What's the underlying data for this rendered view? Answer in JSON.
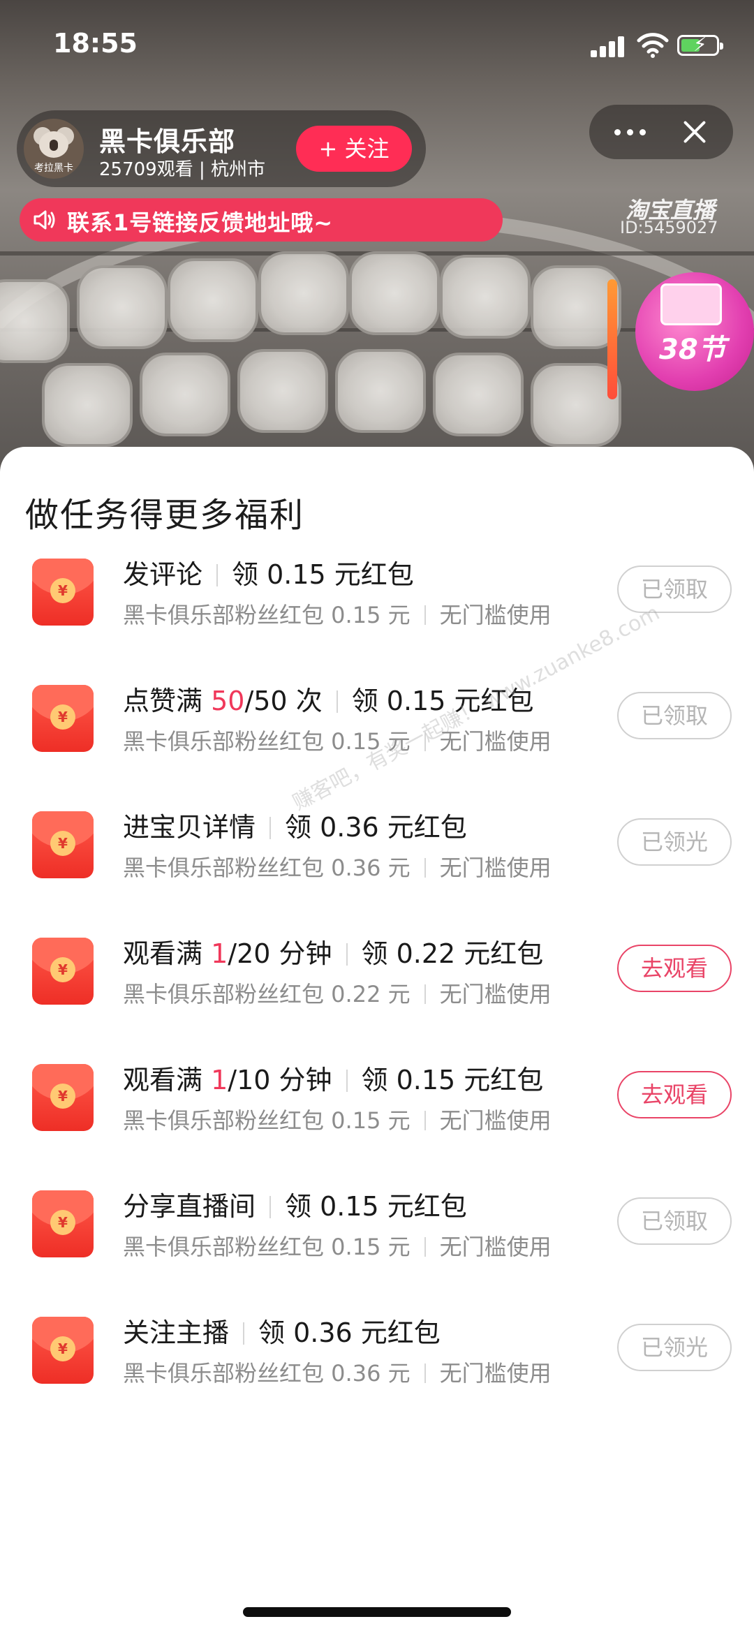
{
  "status_bar": {
    "time": "18:55"
  },
  "anchor": {
    "name": "黑卡俱乐部",
    "meta": "25709观看 | 杭州市",
    "avatar_text": "考拉黑卡",
    "follow_label": "+ 关注"
  },
  "stream": {
    "brand": "淘宝直播",
    "room_id": "ID:5459027",
    "notice": "联系1号链接反馈地址哦~",
    "promo_label": "38节"
  },
  "sheet": {
    "title": "做任务得更多福利",
    "tasks": [
      {
        "action": "发评论",
        "progress_done": "",
        "progress_rest": "",
        "reward": "领 0.15 元红包",
        "sub_left": "黑卡俱乐部粉丝红包 0.15 元",
        "sub_right": "无门槛使用",
        "button": "已领取",
        "button_active": false
      },
      {
        "action": "点赞满 ",
        "progress_done": "50",
        "progress_rest": "/50 次",
        "reward": "领 0.15 元红包",
        "sub_left": "黑卡俱乐部粉丝红包 0.15 元",
        "sub_right": "无门槛使用",
        "button": "已领取",
        "button_active": false
      },
      {
        "action": "进宝贝详情",
        "progress_done": "",
        "progress_rest": "",
        "reward": "领 0.36 元红包",
        "sub_left": "黑卡俱乐部粉丝红包 0.36 元",
        "sub_right": "无门槛使用",
        "button": "已领光",
        "button_active": false
      },
      {
        "action": "观看满 ",
        "progress_done": "1",
        "progress_rest": "/20 分钟",
        "reward": "领 0.22 元红包",
        "sub_left": "黑卡俱乐部粉丝红包 0.22 元",
        "sub_right": "无门槛使用",
        "button": "去观看",
        "button_active": true
      },
      {
        "action": "观看满 ",
        "progress_done": "1",
        "progress_rest": "/10 分钟",
        "reward": "领 0.15 元红包",
        "sub_left": "黑卡俱乐部粉丝红包 0.15 元",
        "sub_right": "无门槛使用",
        "button": "去观看",
        "button_active": true
      },
      {
        "action": "分享直播间",
        "progress_done": "",
        "progress_rest": "",
        "reward": "领 0.15 元红包",
        "sub_left": "黑卡俱乐部粉丝红包 0.15 元",
        "sub_right": "无门槛使用",
        "button": "已领取",
        "button_active": false
      },
      {
        "action": "关注主播",
        "progress_done": "",
        "progress_rest": "",
        "reward": "领 0.36 元红包",
        "sub_left": "黑卡俱乐部粉丝红包 0.36 元",
        "sub_right": "无门槛使用",
        "button": "已领光",
        "button_active": false
      }
    ]
  },
  "watermark": "赚客吧，有奖一起赚！ www.zuanke8.com",
  "colors": {
    "accent": "#f0385a",
    "envelope": "#ee2e26",
    "muted": "#8c8c8c"
  }
}
